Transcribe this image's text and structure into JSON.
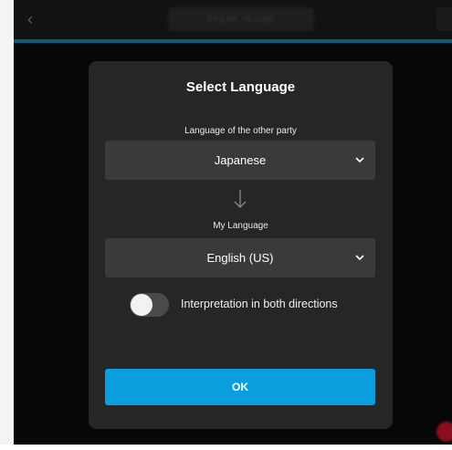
{
  "background": {
    "top_bar_center_text": "SPEAK IN USE"
  },
  "dialog": {
    "title": "Select Language",
    "other_party": {
      "label": "Language of the other party",
      "value": "Japanese"
    },
    "my_language": {
      "label": "My Language",
      "value": "English (US)"
    },
    "toggle": {
      "label": "Interpretation in both directions",
      "on": false
    },
    "ok_label": "OK"
  },
  "colors": {
    "accent": "#0a9fdc",
    "dialog_bg": "#262626",
    "select_bg": "#3a3a3a",
    "app_bg": "#070707"
  },
  "icons": {
    "select_chevron": "chevron-down-icon",
    "direction": "arrow-down-icon",
    "back": "back-arrow-icon"
  }
}
